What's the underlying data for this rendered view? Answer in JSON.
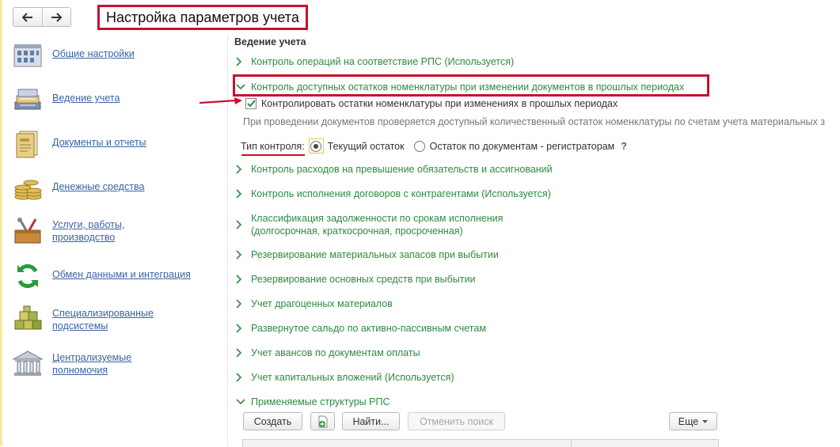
{
  "header": {
    "title": "Настройка параметров учета",
    "back_icon": "arrow-left-icon",
    "forward_icon": "arrow-right-icon"
  },
  "sidebar": {
    "items": [
      {
        "label": "Общие настройки",
        "icon": "building-icon"
      },
      {
        "label": "Ведение учета",
        "icon": "ledger-books-icon"
      },
      {
        "label": "Документы и отчеты",
        "icon": "documents-icon"
      },
      {
        "label": "Денежные средства",
        "icon": "coins-icon"
      },
      {
        "label": "Услуги, работы,\nпроизводство",
        "icon": "toolbox-icon"
      },
      {
        "label": "Обмен данными и интеграция",
        "icon": "sync-icon"
      },
      {
        "label": "Специализированные\nподсистемы",
        "icon": "cubes-icon"
      },
      {
        "label": "Централизуемые\nполномочия",
        "icon": "government-building-icon"
      }
    ]
  },
  "main": {
    "section_title": "Ведение учета",
    "rows": [
      {
        "label": "Контроль операций на соответствие РПС (Используется)",
        "expanded": false
      },
      {
        "label": "Контроль доступных остатков номенклатуры при изменении документов в прошлых периодах",
        "expanded": true
      },
      {
        "label": "Контроль расходов на превышение обязательств и ассигнований",
        "expanded": false
      },
      {
        "label": "Контроль исполнения договоров с контрагентами (Используется)",
        "expanded": false
      },
      {
        "label": "Классификация задолженности по срокам исполнения\n(долгосрочная, краткосрочная, просроченная)",
        "expanded": false
      },
      {
        "label": "Резервирование материальных запасов при выбытии",
        "expanded": false
      },
      {
        "label": "Резервирование основных средств при выбытии",
        "expanded": false
      },
      {
        "label": "Учет драгоценных материалов",
        "expanded": false
      },
      {
        "label": "Развернутое сальдо по активно-пассивным счетам",
        "expanded": false
      },
      {
        "label": "Учет авансов по документам оплаты",
        "expanded": false
      },
      {
        "label": "Учет капитальных вложений (Используется)",
        "expanded": false
      },
      {
        "label": "Применяемые структуры РПС",
        "expanded": true
      }
    ],
    "checkbox": {
      "label": "Контролировать остатки номенклатуры при изменениях в прошлых периодах",
      "checked": true
    },
    "description": "При проведении документов проверяется доступный количественный остаток номенклатуры по счетам учета материальных з",
    "control_type": {
      "label": "Тип контроля:",
      "options": [
        "Текущий остаток",
        "Остаток по документам - регистраторам"
      ],
      "selected": "Текущий остаток",
      "help": "?"
    }
  },
  "toolbar": {
    "create_label": "Создать",
    "find_label": "Найти...",
    "cancel_search_label": "Отменить поиск",
    "more_label": "Еще",
    "add_icon": "add-document-icon"
  },
  "colors": {
    "accent_green": "#2e8b3e",
    "link_blue": "#3b62a4",
    "annotation_red": "#c8102e"
  }
}
